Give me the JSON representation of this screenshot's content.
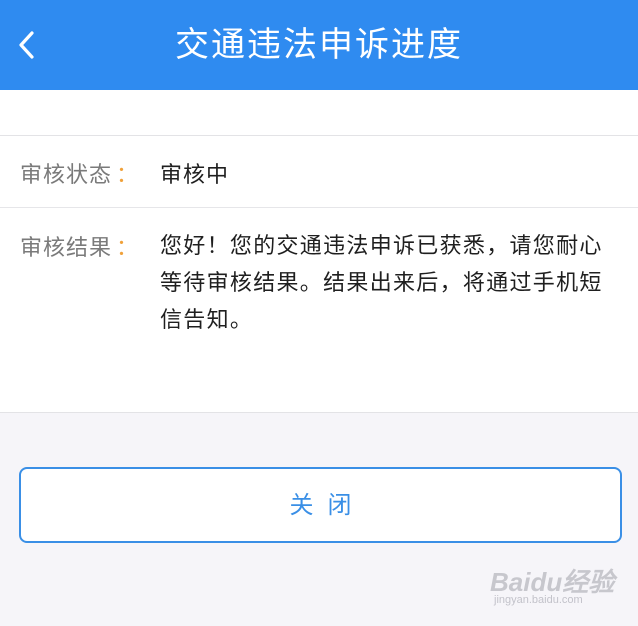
{
  "header": {
    "title": "交通违法申诉进度",
    "back_icon": "chevron-left-icon",
    "background_color": "#2f8bf0"
  },
  "status_row": {
    "label": "审核状态",
    "colon": "：",
    "value": "审核中"
  },
  "result_row": {
    "label": "审核结果",
    "colon": "：",
    "value": "您好！您的交通违法申诉已获悉，请您耐心等待审核结果。结果出来后，将通过手机短信告知。"
  },
  "close_button": {
    "label": "关闭",
    "border_color": "#3a8fe6"
  },
  "watermark": {
    "logo": "Baidu经验",
    "url": "jingyan.baidu.com"
  }
}
